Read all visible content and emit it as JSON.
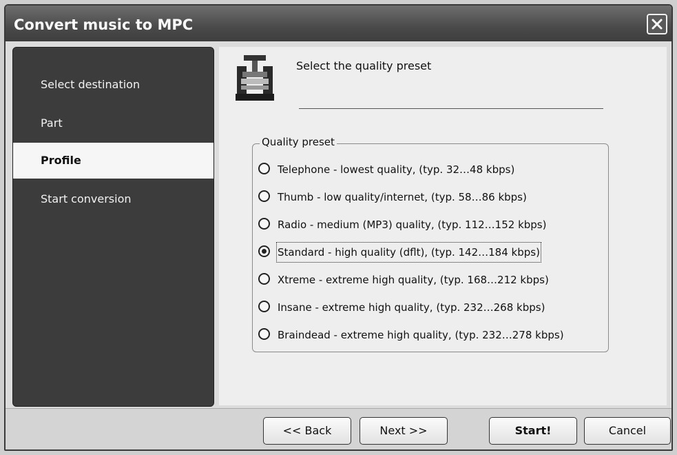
{
  "window": {
    "title": "Convert music to MPC"
  },
  "sidebar": {
    "items": [
      {
        "label": "Select destination",
        "active": false
      },
      {
        "label": "Part",
        "active": false
      },
      {
        "label": "Profile",
        "active": true
      },
      {
        "label": "Start conversion",
        "active": false
      }
    ]
  },
  "header": {
    "title": "Select the quality preset"
  },
  "quality": {
    "group_label": "Quality preset",
    "selected_index": 3,
    "options": [
      "Telephone - lowest quality, (typ.  32…48 kbps)",
      "Thumb  - low quality/internet, (typ.  58…86 kbps)",
      "Radio - medium (MP3) quality, (typ. 112…152 kbps)",
      "Standard - high quality (dflt),  (typ. 142…184 kbps)",
      "Xtreme - extreme high quality, (typ. 168…212 kbps)",
      "Insane - extreme high quality, (typ. 232…268 kbps)",
      "Braindead - extreme high quality, (typ. 232…278 kbps)"
    ]
  },
  "buttons": {
    "back": "<< Back",
    "next": "Next >>",
    "start": "Start!",
    "cancel": "Cancel"
  },
  "icons": {
    "close": "close-icon",
    "app": "press-icon"
  }
}
